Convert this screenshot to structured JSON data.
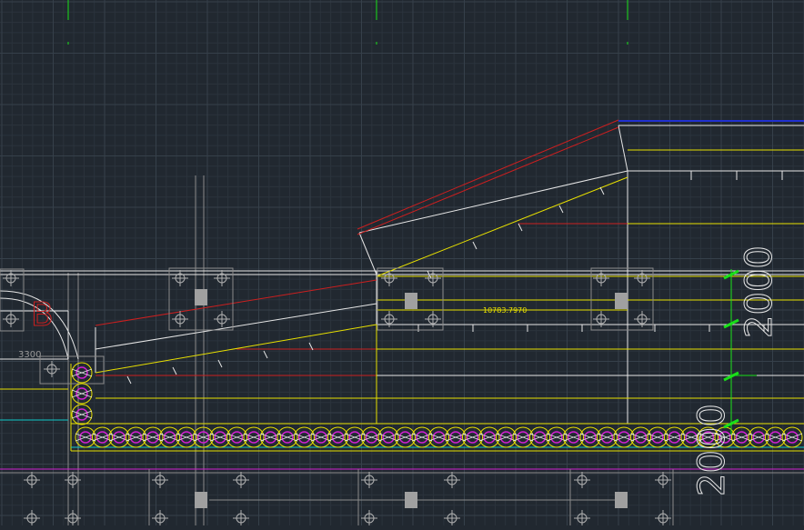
{
  "app": {
    "name": "CAD drawing viewport"
  },
  "colors": {
    "background": "#212830",
    "grid_minor": "#2b333c",
    "grid_major": "#36404a",
    "white": "#e6e6e6",
    "yellow": "#e8e000",
    "red": "#cc1f1f",
    "blue": "#2030d0",
    "green": "#19e019",
    "magenta": "#d020d0",
    "cyan": "#10c8c8",
    "gray": "#8a8a8a",
    "block": "#a0a0a0"
  },
  "annotations": {
    "label_3300": "3300",
    "label_length": "10783.7970",
    "dim_2000_right": "2000",
    "dim_2000_bottom": "2000",
    "letter_b": "B"
  }
}
